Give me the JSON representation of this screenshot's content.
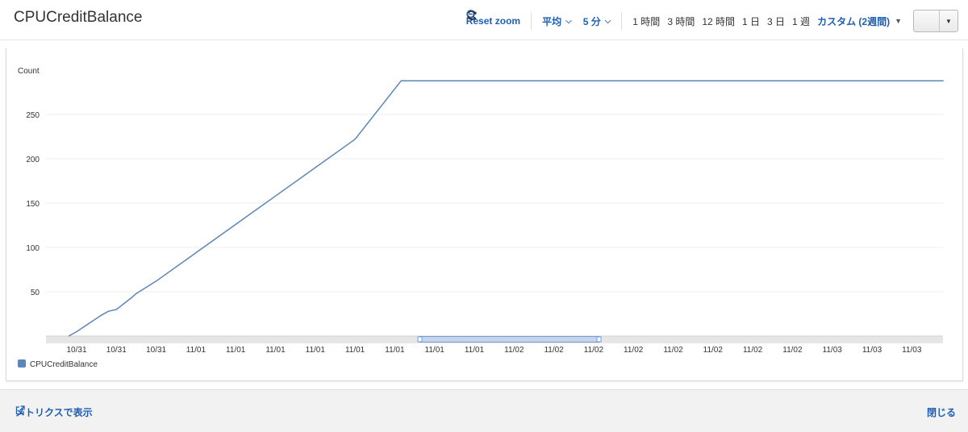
{
  "header": {
    "title": "CPUCreditBalance",
    "reset_zoom": "Reset zoom",
    "stat": "平均",
    "period": "5 分",
    "ranges": [
      "1 時間",
      "3 時間",
      "12 時間",
      "1 日",
      "3 日",
      "1 週"
    ],
    "custom_range": "カスタム (2週間)"
  },
  "footer": {
    "view_in_metrics": "メトリクスで表示",
    "close": "閉じる"
  },
  "colors": {
    "series": "#5a86b8",
    "link": "#1e5fb4"
  },
  "chart_data": {
    "type": "line",
    "ylabel": "Count",
    "yticks": [
      50,
      100,
      150,
      200,
      250
    ],
    "ylim": [
      0,
      300
    ],
    "grid": true,
    "legend_position": "bottom-left",
    "x_tick_labels": [
      "10/31",
      "10/31",
      "10/31",
      "11/01",
      "11/01",
      "11/01",
      "11/01",
      "11/01",
      "11/01",
      "11/01",
      "11/01",
      "11/02",
      "11/02",
      "11/02",
      "11/02",
      "11/02",
      "11/02",
      "11/02",
      "11/02",
      "11/03",
      "11/03",
      "11/03"
    ],
    "series": [
      {
        "name": "CPUCreditBalance",
        "color": "#5a86b8",
        "x_tick_index": [
          -0.2,
          0.0,
          0.3,
          0.6,
          0.8,
          1.0,
          1.4,
          1.5,
          2.0,
          3.0,
          4.0,
          5.0,
          6.0,
          7.0,
          8.16,
          21.8
        ],
        "values": [
          0,
          5,
          14,
          23,
          28,
          30,
          44,
          48,
          62,
          94,
          126,
          158,
          190,
          222,
          288,
          288
        ]
      }
    ]
  }
}
